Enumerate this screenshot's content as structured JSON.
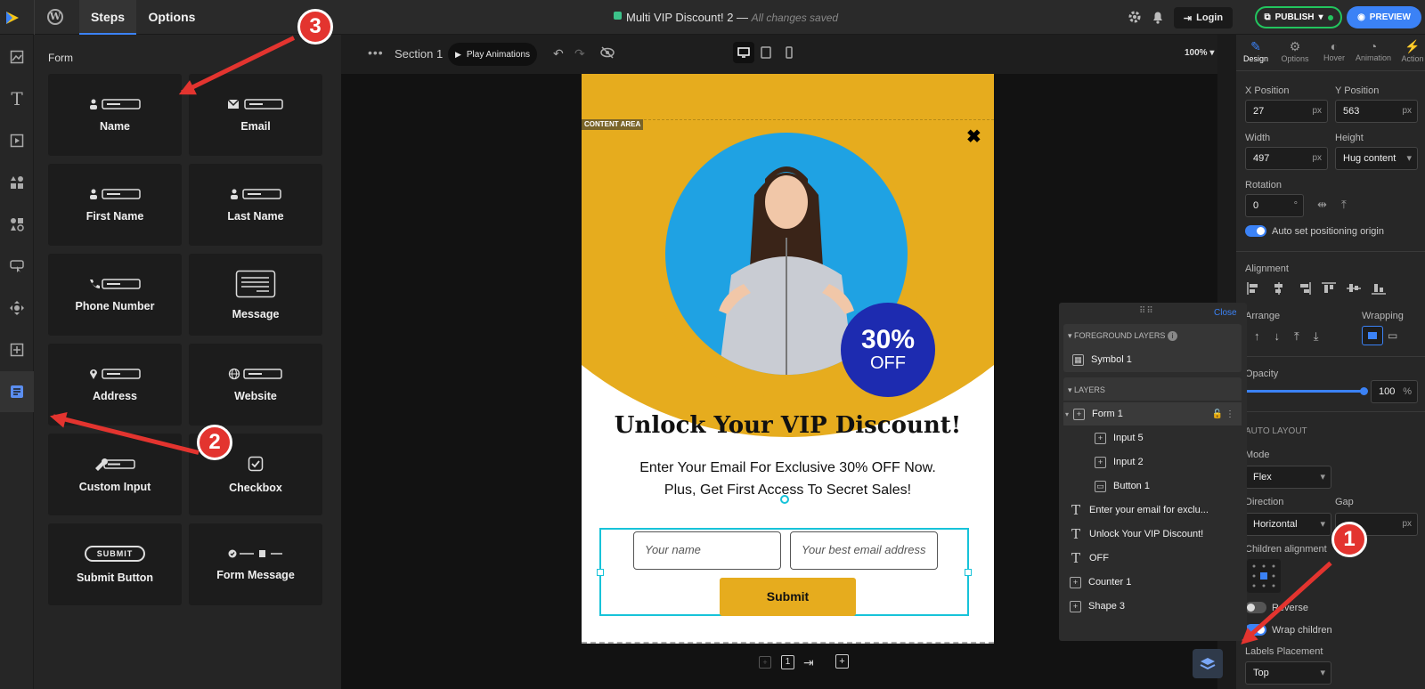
{
  "app": {
    "doc_title": "Multi VIP Discount! 2",
    "save_status": "All changes saved",
    "publish_label": "PUBLISH",
    "preview_label": "PREVIEW",
    "login_label": "Login"
  },
  "tabs": {
    "steps": "Steps",
    "options": "Options"
  },
  "panel": {
    "heading": "Form",
    "tiles": [
      {
        "label": "Name",
        "icon": "person-field-icon"
      },
      {
        "label": "Email",
        "icon": "envelope-field-icon"
      },
      {
        "label": "First Name",
        "icon": "person-field-icon"
      },
      {
        "label": "Last Name",
        "icon": "person-field-icon"
      },
      {
        "label": "Phone Number",
        "icon": "phone-field-icon"
      },
      {
        "label": "Message",
        "icon": "message-box-icon"
      },
      {
        "label": "Address",
        "icon": "pin-field-icon"
      },
      {
        "label": "Website",
        "icon": "globe-field-icon"
      },
      {
        "label": "Custom Input",
        "icon": "wrench-field-icon"
      },
      {
        "label": "Checkbox",
        "icon": "checkbox-icon"
      },
      {
        "label": "Submit Button",
        "icon": "submit-button-icon",
        "btn_text": "SUBMIT"
      },
      {
        "label": "Form Message",
        "icon": "form-message-icon"
      }
    ]
  },
  "canvasbar": {
    "section": "Section 1",
    "play": "Play Animations",
    "zoom": "100%"
  },
  "popup": {
    "content_tag": "CONTENT AREA",
    "badge_pct": "30%",
    "badge_off": "OFF",
    "headline": "Unlock Your VIP Discount!",
    "sub1": "Enter Your Email For Exclusive 30% OFF Now.",
    "sub2": "Plus, Get First Access To Secret Sales!",
    "name_placeholder": "Your name",
    "email_placeholder": "Your best email address",
    "submit": "Submit",
    "colors": {
      "gold": "#e6ac1e",
      "blue": "#1fa2e3",
      "badge": "#1d2bb0"
    }
  },
  "page_counter": "1",
  "right": {
    "tabs": [
      "Design",
      "Options",
      "Hover",
      "Animation",
      "Action"
    ],
    "xpos_label": "X Position",
    "xpos": "27",
    "ypos_label": "Y Position",
    "ypos": "563",
    "unit": "px",
    "width_label": "Width",
    "width": "497",
    "height_label": "Height",
    "height": "Hug content",
    "rotation_label": "Rotation",
    "rotation": "0",
    "rot_unit": "°",
    "auto_origin": "Auto set positioning origin",
    "alignment": "Alignment",
    "arrange": "Arrange",
    "wrapping": "Wrapping",
    "opacity": "Opacity",
    "opacity_val": "100",
    "pct": "%",
    "auto_layout": "AUTO LAYOUT",
    "mode_label": "Mode",
    "mode": "Flex",
    "direction_label": "Direction",
    "direction": "Horizontal",
    "gap_label": "Gap",
    "children_align": "Children alignment",
    "reverse": "Reverse",
    "wrap_children": "Wrap children",
    "labels_placement": "Labels Placement",
    "labels_val": "Top"
  },
  "layers": {
    "close": "Close",
    "fg_header": "FOREGROUND LAYERS",
    "fg_items": [
      "Symbol 1"
    ],
    "layers_header": "LAYERS",
    "items": [
      {
        "name": "Form 1",
        "kind": "box"
      },
      {
        "name": "Input 5",
        "kind": "box"
      },
      {
        "name": "Input 2",
        "kind": "box"
      },
      {
        "name": "Button 1",
        "kind": "btn"
      },
      {
        "name": "Enter your email for exclu...",
        "kind": "text"
      },
      {
        "name": "Unlock Your VIP Discount!",
        "kind": "text"
      },
      {
        "name": "OFF",
        "kind": "text"
      },
      {
        "name": "Counter 1",
        "kind": "box"
      },
      {
        "name": "Shape 3",
        "kind": "box"
      }
    ]
  },
  "annotations": {
    "one": "1",
    "two": "2",
    "three": "3"
  }
}
